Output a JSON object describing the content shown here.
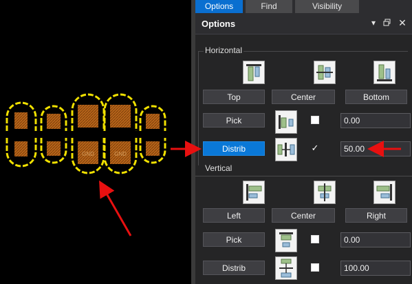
{
  "tabs": [
    {
      "label": "Options",
      "active": true
    },
    {
      "label": "Find",
      "active": false
    },
    {
      "label": "Visibility",
      "active": false
    }
  ],
  "panel": {
    "title": "Options",
    "header_icons": [
      "dropdown-icon",
      "restore-icon",
      "close-icon"
    ]
  },
  "horizontal": {
    "label": "Horizontal",
    "align_buttons": [
      "Top",
      "Center",
      "Bottom"
    ],
    "pick": {
      "label": "Pick",
      "checked": false,
      "value": "0.00"
    },
    "distrib": {
      "label": "Distrib",
      "checked": true,
      "value": "50.00",
      "active": true
    }
  },
  "vertical": {
    "label": "Vertical",
    "align_buttons": [
      "Left",
      "Center",
      "Right"
    ],
    "pick": {
      "label": "Pick",
      "checked": false,
      "value": "0.00"
    },
    "distrib": {
      "label": "Distrib",
      "checked": false,
      "value": "100.00"
    }
  },
  "pcb": {
    "pad_labels": [
      "GND",
      "GND"
    ]
  },
  "colors": {
    "accent": "#0a78d7",
    "arrow": "#e81010",
    "pad_fill": "#b8651a",
    "pad_outline": "#f0e000",
    "pad_outline_alt": "#cfcfcf"
  }
}
